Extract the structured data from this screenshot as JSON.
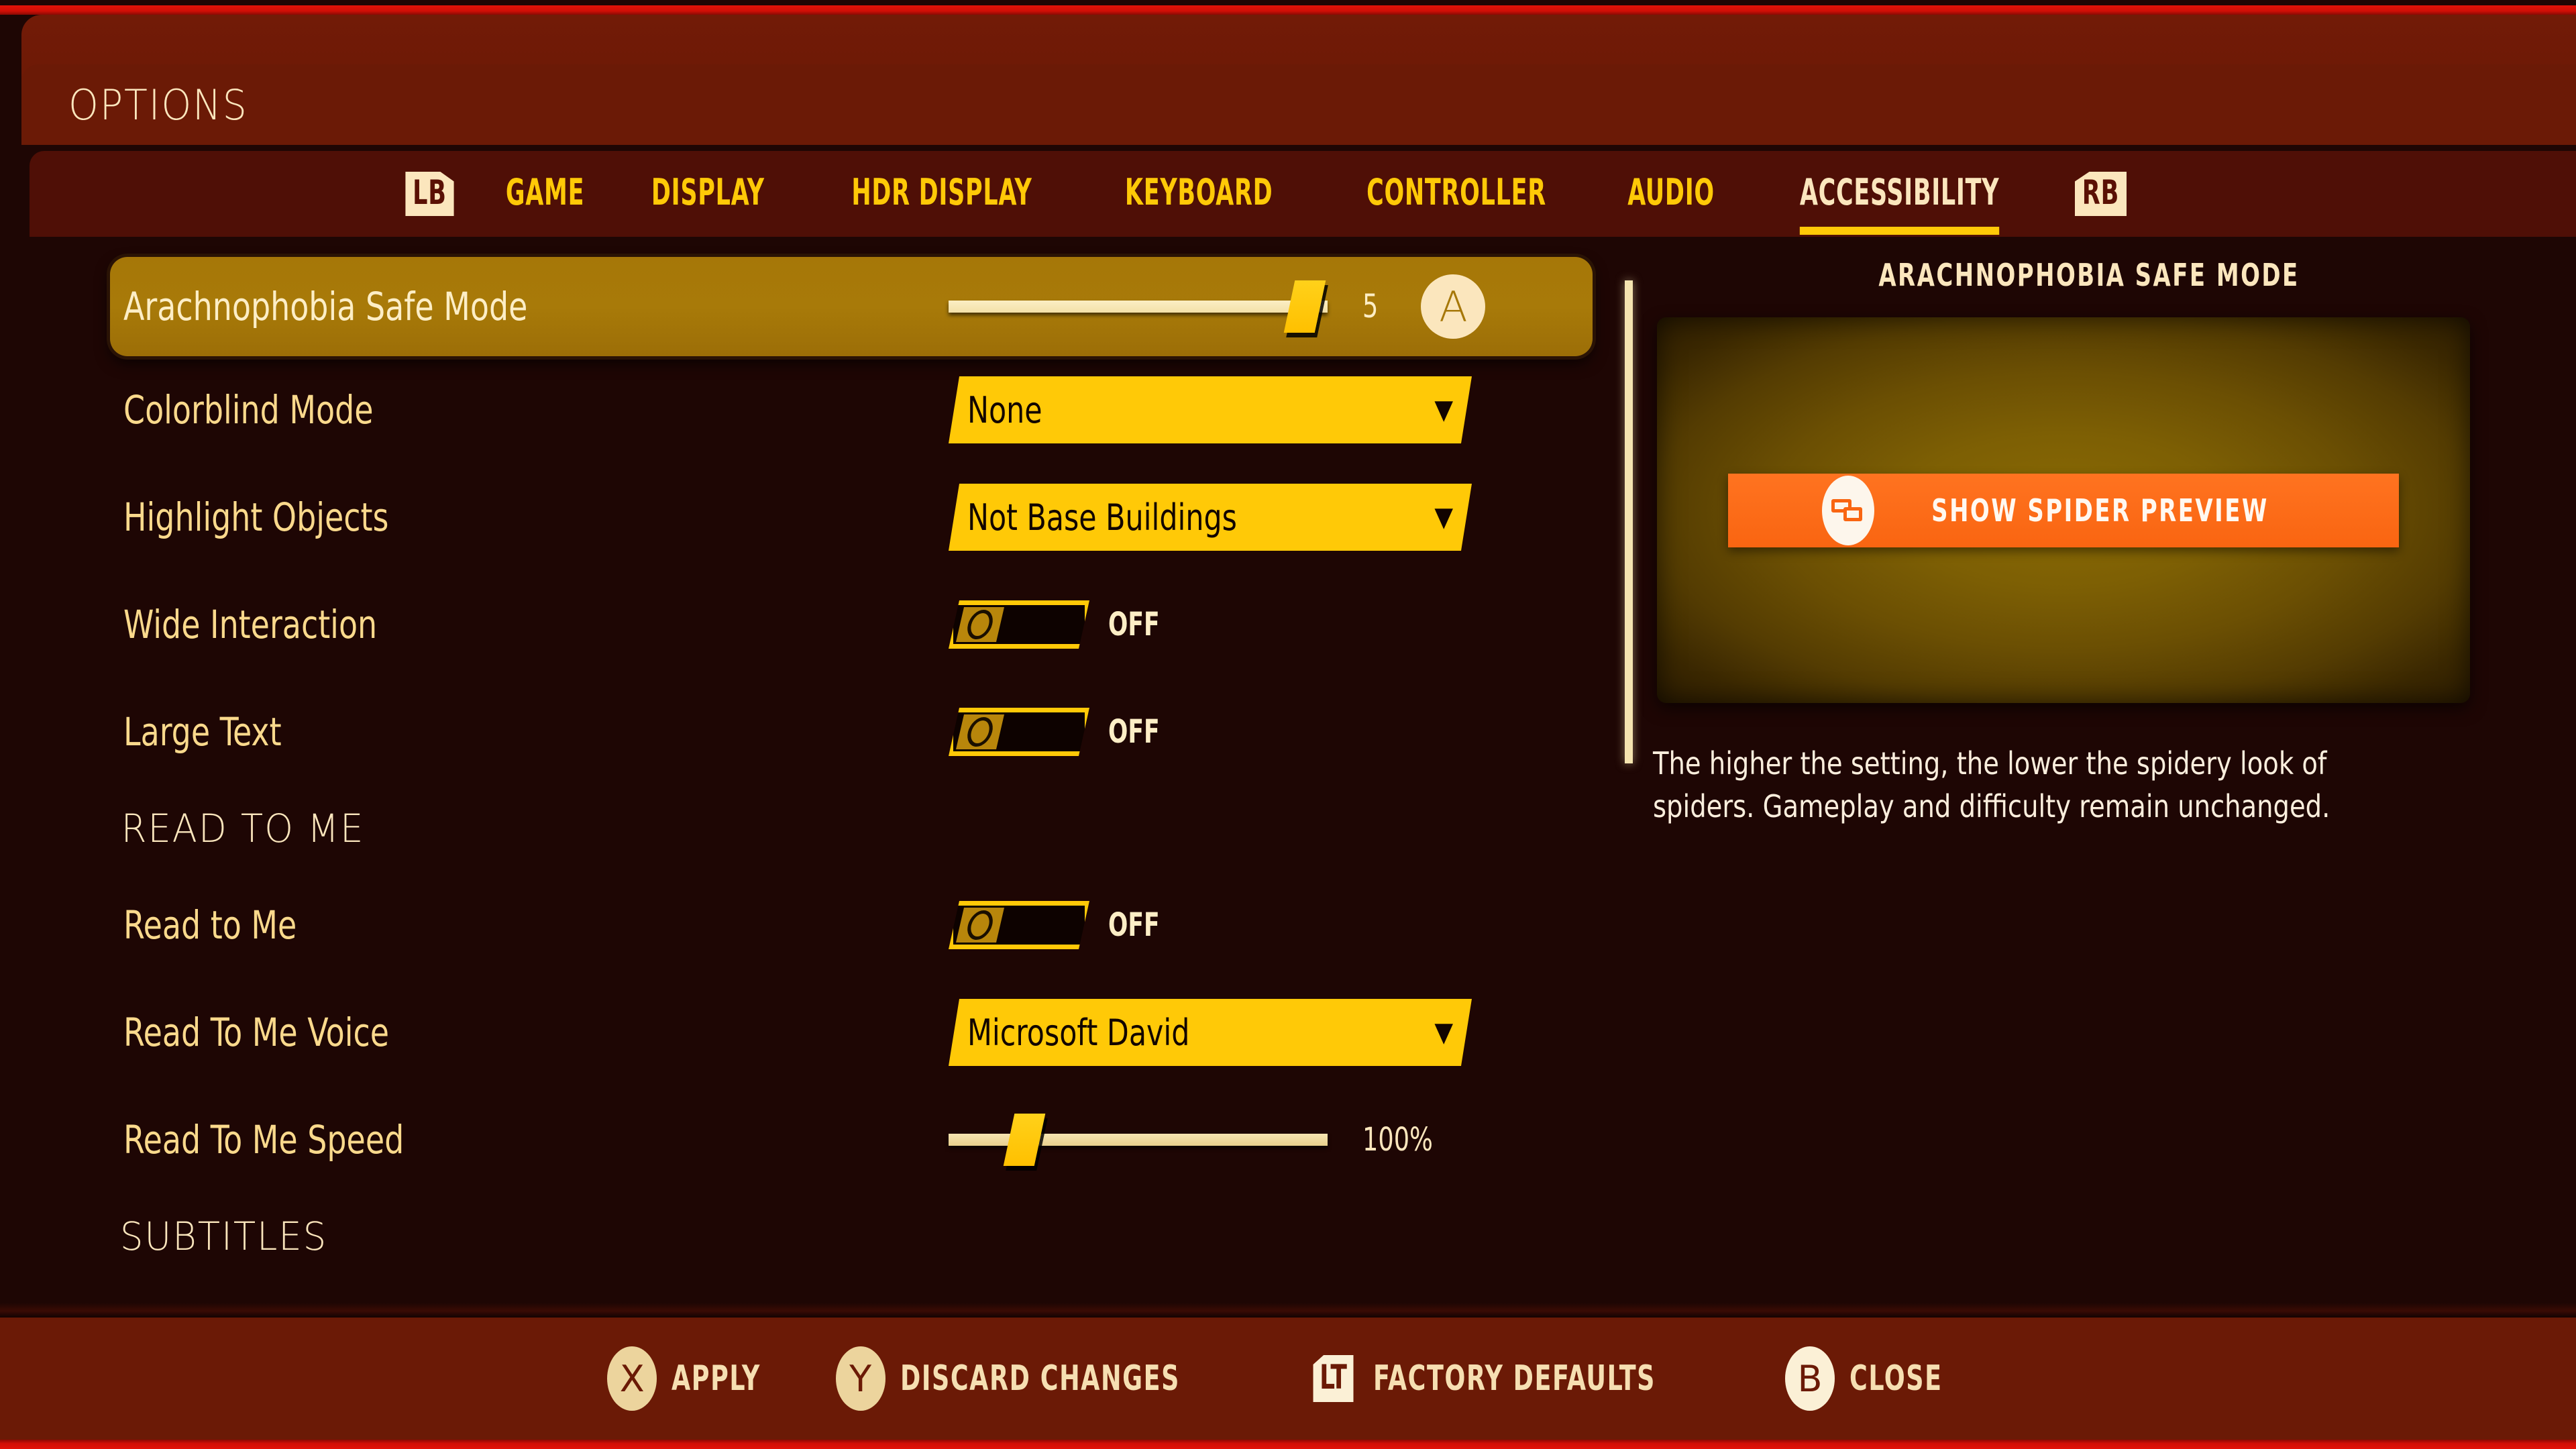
{
  "window": {
    "title": "OPTIONS"
  },
  "tabs": {
    "prev_shoulder": "LB",
    "next_shoulder": "RB",
    "items": [
      {
        "label": "GAME",
        "active": false
      },
      {
        "label": "DISPLAY",
        "active": false
      },
      {
        "label": "HDR DISPLAY",
        "active": false
      },
      {
        "label": "KEYBOARD",
        "active": false
      },
      {
        "label": "CONTROLLER",
        "active": false
      },
      {
        "label": "AUDIO",
        "active": false
      },
      {
        "label": "ACCESSIBILITY",
        "active": true
      }
    ]
  },
  "options": [
    {
      "label": "Arachnophobia Safe Mode",
      "type": "slider",
      "value": "5",
      "percent": 94,
      "selected": true,
      "badge": "A"
    },
    {
      "label": "Colorblind Mode",
      "type": "dropdown",
      "value": "None",
      "selected": false
    },
    {
      "label": "Highlight Objects",
      "type": "dropdown",
      "value": "Not Base Buildings",
      "selected": false
    },
    {
      "label": "Wide Interaction",
      "type": "toggle",
      "value": "OFF",
      "selected": false
    },
    {
      "label": "Large Text",
      "type": "toggle",
      "value": "OFF",
      "selected": false
    }
  ],
  "section_read_to_me": {
    "heading": "READ TO ME",
    "options": [
      {
        "label": "Read to Me",
        "type": "toggle",
        "value": "OFF",
        "selected": false
      },
      {
        "label": "Read To Me Voice",
        "type": "dropdown",
        "value": "Microsoft David",
        "selected": false
      },
      {
        "label": "Read To Me Speed",
        "type": "slider",
        "value": "100%",
        "percent": 20,
        "selected": false
      }
    ]
  },
  "section_next_partial": {
    "heading": "SUBTITLES"
  },
  "info_panel": {
    "title": "ARACHNOPHOBIA SAFE MODE",
    "preview_button_label": "SHOW SPIDER PREVIEW",
    "preview_button_icon": "spider-preview-icon",
    "description": "The higher the setting, the lower the spidery look of spiders. Gameplay and difficulty remain unchanged."
  },
  "footer": {
    "items": [
      {
        "button": "X",
        "style": "circle",
        "label": "APPLY"
      },
      {
        "button": "Y",
        "style": "circle",
        "label": "DISCARD CHANGES"
      },
      {
        "button": "LT",
        "style": "trigger",
        "label": "FACTORY DEFAULTS"
      },
      {
        "button": "B",
        "style": "circle",
        "label": "CLOSE"
      }
    ]
  },
  "colors": {
    "accent_yellow": "#ffc907",
    "cream": "#fbe6bd",
    "label_tan": "#fad98c",
    "selected_gold": "#a67708",
    "header_red": "#6b1a06",
    "tabs_red": "#4f0f06",
    "bg_dark": "#1e0604",
    "bright_red": "#e21208",
    "preview_orange": "#f96511"
  }
}
